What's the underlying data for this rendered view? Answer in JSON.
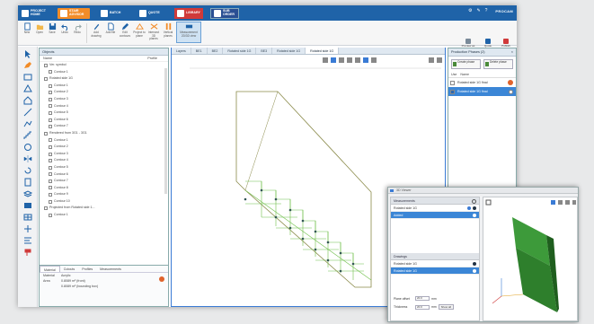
{
  "topbar": {
    "tabs": [
      {
        "label": "PROJECT HOME",
        "icon": "home-icon"
      },
      {
        "label": "STAIR ADVISOR",
        "icon": "stair-icon"
      },
      {
        "label": "BATCH",
        "icon": "batch-icon"
      },
      {
        "label": "QUOTE",
        "icon": "quote-icon"
      },
      {
        "label": "LIBRARY",
        "icon": "library-icon"
      },
      {
        "label": "SUB ORDER",
        "icon": "order-icon"
      }
    ],
    "brand": "PROCAM",
    "icons": [
      "gear-icon",
      "pin-icon",
      "help-icon"
    ]
  },
  "ribbon": {
    "buttons": [
      {
        "label": "New",
        "icon": "new-icon"
      },
      {
        "label": "Open",
        "icon": "open-icon"
      },
      {
        "label": "Save",
        "icon": "save-icon"
      },
      {
        "label": "Undo",
        "icon": "undo-icon"
      },
      {
        "label": "Redo",
        "icon": "redo-icon"
      },
      {
        "label": "Add drawing",
        "icon": "add-drawing-icon"
      },
      {
        "label": "Add file",
        "icon": "add-file-icon"
      },
      {
        "label": "Edit contours",
        "icon": "edit-icon"
      },
      {
        "label": "Project to plane",
        "icon": "project-icon"
      },
      {
        "label": "Intersect 3D planes",
        "icon": "intersect-icon"
      },
      {
        "label": "Vertical planes",
        "icon": "vertical-icon"
      },
      {
        "label": "Measurement 2D/3D view",
        "icon": "measure-icon"
      }
    ],
    "right_buttons": [
      {
        "label": "Preview as beam",
        "icon": "preview-icon"
      },
      {
        "label": "Quote",
        "icon": "quote-btn-icon"
      },
      {
        "label": "Publish",
        "icon": "publish-icon"
      }
    ]
  },
  "tree": {
    "header": "Objects",
    "col_name": "Name",
    "col_profile": "Profile",
    "rows": [
      "Ver. symbol",
      "Contour 1",
      "Rotated side 1G",
      "Contour 1",
      "Contour 2",
      "Contour 3",
      "Contour 4",
      "Contour 5",
      "Contour 6",
      "Contour 7",
      "Rendered from 3G1 - 3G1",
      "Contour 1",
      "Contour 2",
      "Contour 3",
      "Contour 4",
      "Contour 5",
      "Contour 6",
      "Contour 7",
      "Contour 8",
      "Contour 9",
      "Contour 10",
      "Projected from Rotated side 1...",
      "Contour 1"
    ]
  },
  "props": {
    "tabs": [
      "Material",
      "Cutouts",
      "Profiles",
      "Measurements"
    ],
    "rows": [
      {
        "k": "Material",
        "v": "Acrylic"
      },
      {
        "k": "Area",
        "v": "0.8089 m² (front)"
      },
      {
        "k": "",
        "v": "0.8089 m² (bounding box)"
      }
    ]
  },
  "view": {
    "tabs": [
      "Layers",
      "BE1",
      "BE2",
      "Rotated side 1G",
      "BE3",
      "Rotated side 1G",
      "Rotated side 1G"
    ],
    "active_tab": 6
  },
  "rpanel": {
    "header": "Production Phases (2)",
    "btn1": "Create phase",
    "btn2": "Delete phase",
    "col1": "Use",
    "col2": "Name",
    "items": [
      {
        "label": "Rotated side 1G final",
        "selected": false
      },
      {
        "label": "Rotated side 1G final",
        "selected": true
      }
    ]
  },
  "float": {
    "title": "3D Viewer",
    "measurements_title": "Measurements",
    "measurements": [
      "Rotated side 1G",
      "Added"
    ],
    "drawings_title": "Drawings",
    "drawings": [
      "Rotated side 1G",
      "Rotated side 1G"
    ],
    "plane_offset_label": "Plane offset",
    "plane_offset_value": "20.0",
    "plane_offset_unit": "mm",
    "thickness_label": "Thickness",
    "thickness_value": "20.0",
    "thickness_unit": "mm",
    "show_all_label": "Show all"
  }
}
